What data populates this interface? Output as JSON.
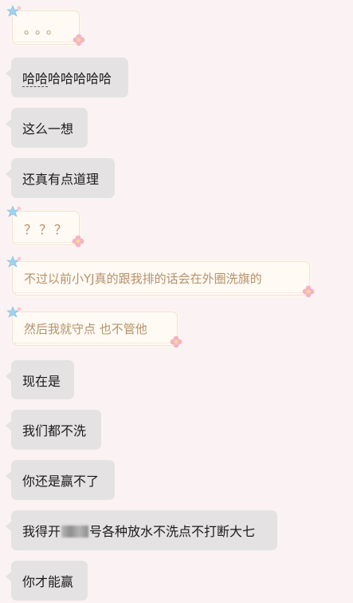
{
  "messages": [
    {
      "style": "cute",
      "text": "。。。"
    },
    {
      "style": "gray",
      "text_a": "哈哈",
      "text_b": "哈哈哈哈哈"
    },
    {
      "style": "gray",
      "text": "这么一想"
    },
    {
      "style": "gray",
      "text": "还真有点道理"
    },
    {
      "style": "cute",
      "text": "？？？"
    },
    {
      "style": "cute",
      "text": "不过以前小YJ真的跟我排的话会在外圈洗旗的"
    },
    {
      "style": "cute",
      "text": "然后我就守点 也不管他"
    },
    {
      "style": "gray",
      "text": "现在是"
    },
    {
      "style": "gray",
      "text": "我们都不洗"
    },
    {
      "style": "gray",
      "text": "你还是赢不了"
    },
    {
      "style": "gray",
      "text_before": "我得开",
      "text_after": "号各种放水不洗点不打断大七"
    },
    {
      "style": "gray",
      "text": "你才能赢"
    }
  ],
  "decorations": {
    "star_color": "#9fd3ef",
    "star_accent": "#f7c9d8",
    "flower_color": "#f3b4c6",
    "flower_center": "#f6d98c",
    "icon_names": [
      "bubble-star-icon",
      "bubble-flower-icon"
    ]
  }
}
